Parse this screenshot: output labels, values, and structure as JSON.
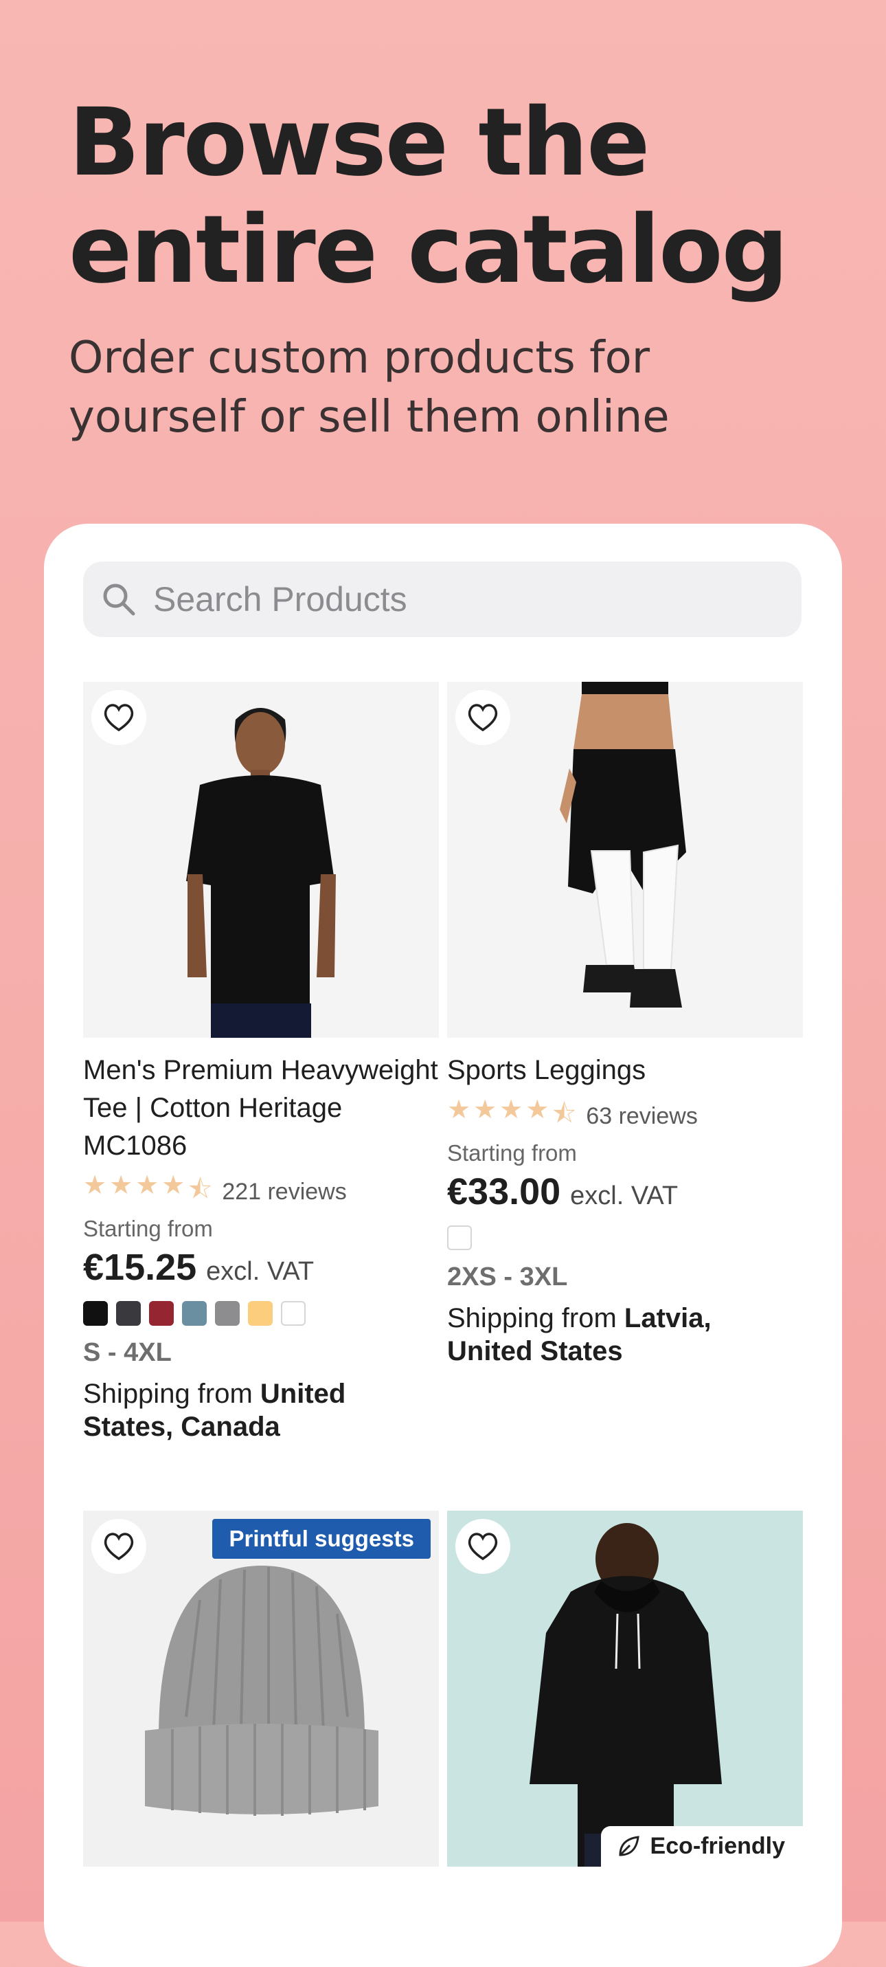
{
  "hero": {
    "title_line1": "Browse the",
    "title_line2": "entire catalog",
    "subtitle_line1": "Order custom products for",
    "subtitle_line2": "yourself or sell them online"
  },
  "search": {
    "placeholder": "Search Products",
    "icon": "search-icon"
  },
  "products": [
    {
      "title": "Men's Premium Heavyweight Tee | Cotton Heritage MC1086",
      "rating": 4.5,
      "reviews": "221 reviews",
      "starting_from": "Starting from",
      "price": "€15.25",
      "vat": "excl. VAT",
      "colors": [
        "#111111",
        "#3a3a3e",
        "#952531",
        "#6a8fa0",
        "#8d8d90",
        "#fbcd7d",
        "#ffffff"
      ],
      "sizes": "S - 4XL",
      "shipping_prefix": "Shipping from ",
      "shipping_places": "United States, Canada"
    },
    {
      "title": "Sports Leggings",
      "rating": 4.5,
      "reviews": "63 reviews",
      "starting_from": "Starting from",
      "price": "€33.00",
      "vat": "excl. VAT",
      "colors": [
        "#ffffff"
      ],
      "sizes": "2XS - 3XL",
      "shipping_prefix": "Shipping from ",
      "shipping_places": "Latvia, United States"
    },
    {
      "badge": "Printful suggests"
    },
    {
      "badge": "Eco-friendly"
    }
  ],
  "colors": {
    "accent_badge": "#1f5cad",
    "star": "#f3c99c",
    "background": "#f8b7b3"
  }
}
